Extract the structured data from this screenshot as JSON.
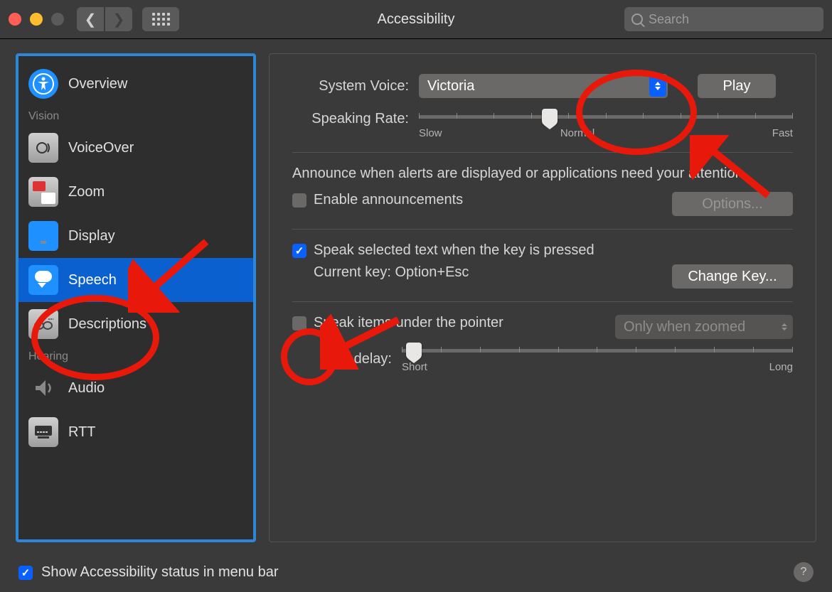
{
  "window": {
    "title": "Accessibility"
  },
  "search": {
    "placeholder": "Search"
  },
  "sidebar": {
    "overview": "Overview",
    "section_vision": "Vision",
    "voiceover": "VoiceOver",
    "zoom": "Zoom",
    "display": "Display",
    "speech": "Speech",
    "descriptions": "Descriptions",
    "section_hearing": "Hearing",
    "audio": "Audio",
    "rtt": "RTT"
  },
  "main": {
    "system_voice_label": "System Voice:",
    "system_voice_value": "Victoria",
    "play_label": "Play",
    "speaking_rate_label": "Speaking Rate:",
    "rate_slow": "Slow",
    "rate_normal": "Normal",
    "rate_fast": "Fast",
    "announce_text": "Announce when alerts are displayed or applications need your attention.",
    "enable_announcements_label": "Enable announcements",
    "options_label": "Options...",
    "speak_selected_label": "Speak selected text when the key is pressed",
    "current_key_label": "Current key: Option+Esc",
    "change_key_label": "Change Key...",
    "speak_pointer_label": "Speak items under the pointer",
    "pointer_mode": "Only when zoomed",
    "after_delay_label": "After delay:",
    "delay_short": "Short",
    "delay_long": "Long"
  },
  "footer": {
    "show_status_label": "Show Accessibility status in menu bar"
  }
}
